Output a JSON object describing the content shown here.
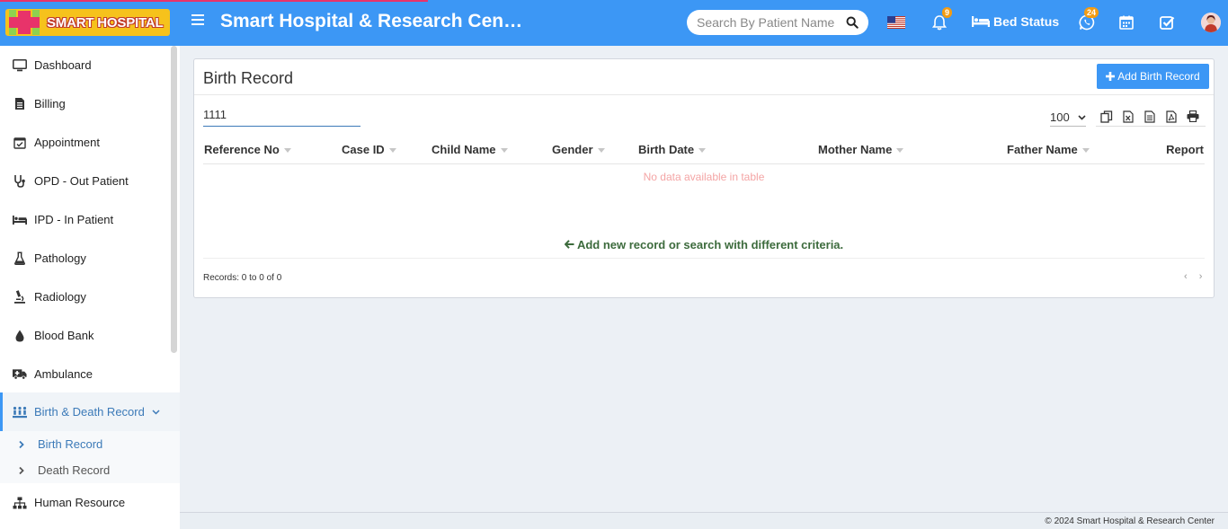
{
  "header": {
    "logo_text": "SMART HOSPITAL",
    "title": "Smart Hospital & Research Cen…",
    "search_placeholder": "Search By Patient Name",
    "notifications_count": "9",
    "bed_status_label": "Bed Status",
    "whatsapp_count": "24",
    "colors": {
      "bar": "#3c97f5",
      "logo_bg": "#f6c21c",
      "badge": "#f39c12"
    }
  },
  "sidebar": {
    "items": [
      {
        "label": "Dashboard",
        "icon": "monitor-icon"
      },
      {
        "label": "Billing",
        "icon": "file-icon"
      },
      {
        "label": "Appointment",
        "icon": "calendar-check-icon"
      },
      {
        "label": "OPD - Out Patient",
        "icon": "stethoscope-icon"
      },
      {
        "label": "IPD - In Patient",
        "icon": "bed-icon"
      },
      {
        "label": "Pathology",
        "icon": "flask-icon"
      },
      {
        "label": "Radiology",
        "icon": "microscope-icon"
      },
      {
        "label": "Blood Bank",
        "icon": "tint-icon"
      },
      {
        "label": "Ambulance",
        "icon": "ambulance-icon"
      },
      {
        "label": "Birth & Death Record",
        "icon": "family-icon"
      },
      {
        "label": "Human Resource",
        "icon": "sitemap-icon"
      }
    ],
    "subitems": [
      {
        "label": "Birth Record"
      },
      {
        "label": "Death Record"
      }
    ]
  },
  "main": {
    "title": "Birth Record",
    "add_button": "Add Birth Record",
    "filter_value": "1111",
    "page_size": "100",
    "columns": [
      "Reference No",
      "Case ID",
      "Child Name",
      "Gender",
      "Birth Date",
      "Mother Name",
      "Father Name",
      "Report"
    ],
    "empty_message": "No data available in table",
    "hint": "Add new record or search with different criteria.",
    "records_info": "Records: 0 to 0 of 0",
    "pager_prev": "‹",
    "pager_next": "›"
  },
  "footer": {
    "copyright": "© 2024 Smart Hospital & Research Center"
  }
}
